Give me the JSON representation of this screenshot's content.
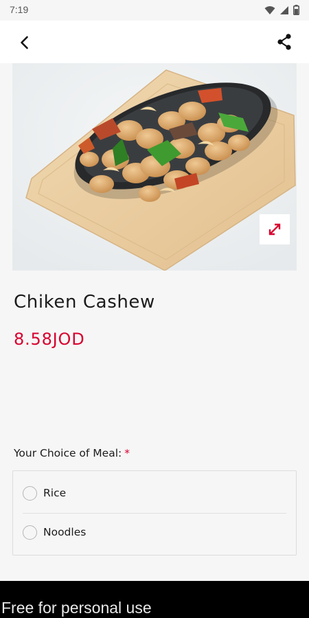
{
  "status_bar": {
    "time": "7:19",
    "icons": [
      "wifi-icon",
      "signal-icon",
      "battery-icon"
    ]
  },
  "app_bar": {
    "back_icon": "back-arrow-icon",
    "share_icon": "share-icon"
  },
  "product": {
    "image": "dish-photo",
    "expand_icon": "expand-icon",
    "name": "Chiken Cashew",
    "price": "8.58JOD"
  },
  "options": {
    "label": "Your Choice of Meal:",
    "required_mark": "*",
    "items": [
      {
        "label": "Rice",
        "selected": false
      },
      {
        "label": "Noodles",
        "selected": false
      }
    ]
  },
  "footer": {
    "text": "Free for personal use"
  },
  "colors": {
    "accent": "#d8002f",
    "background": "#f6f6f6",
    "text": "#1b1b1b",
    "footer": "#000000"
  }
}
